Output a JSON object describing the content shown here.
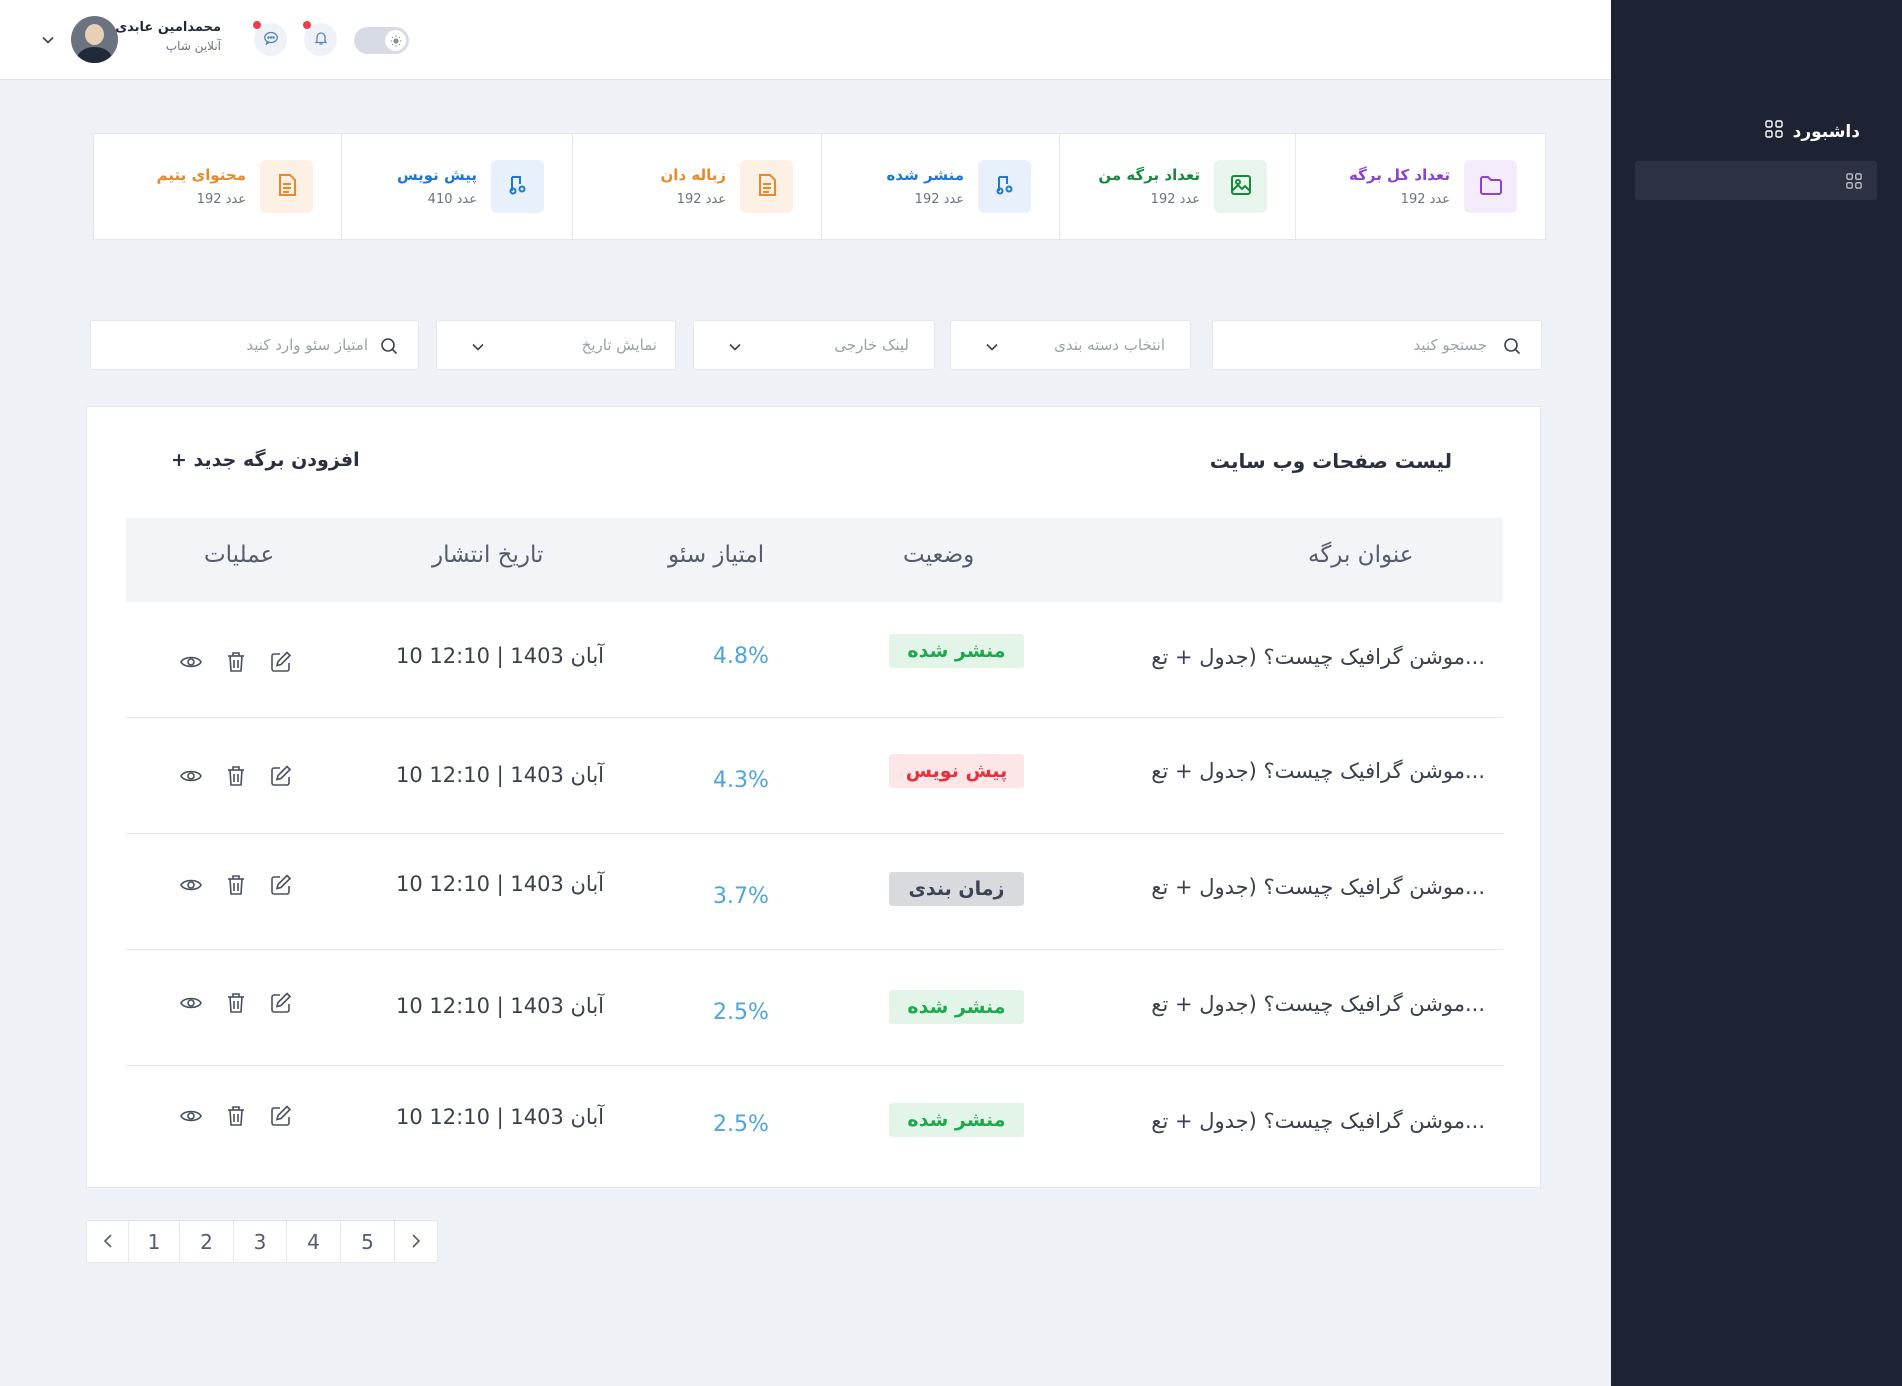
{
  "sidebar": {
    "title": "داشبورد",
    "title_icon": "grid-icon",
    "active_item_icon": "grid-icon"
  },
  "header": {
    "user_name": "محمدامین عابدی",
    "user_role": "آنلاین شاپ",
    "avatar": "user-avatar",
    "icons": [
      "chevron-down-icon",
      "chat-icon",
      "bell-icon",
      "theme-toggle"
    ],
    "notification_dot_color": "#ef3b4e"
  },
  "stats": [
    {
      "label": "تعداد کل برگه",
      "count": "192 عدد",
      "icon": "folder-icon",
      "color": "#8e3fd6",
      "bg": "#f4ecfb"
    },
    {
      "label": "تعداد برگه من",
      "count": "192 عدد",
      "icon": "image-icon",
      "color": "#168a3c",
      "bg": "#e8f5ec"
    },
    {
      "label": "منشر شده",
      "count": "192 عدد",
      "icon": "music-note-icon",
      "color": "#1f78d1",
      "bg": "#e8f1fb"
    },
    {
      "label": "زباله دان",
      "count": "192 عدد",
      "icon": "document-icon",
      "color": "#e98a2a",
      "bg": "#fdf1e6"
    },
    {
      "label": "پیش نویس",
      "count": "410 عدد",
      "icon": "music-note-icon",
      "color": "#1f78d1",
      "bg": "#e8f1fb"
    },
    {
      "label": "محتوای یتیم",
      "count": "192 عدد",
      "icon": "document-icon",
      "color": "#e98a2a",
      "bg": "#fdf1e6"
    }
  ],
  "filters": {
    "search_placeholder": "جستجو کنید",
    "category_placeholder": "انتخاب دسته بندی",
    "external_link_placeholder": "لینک خارجی",
    "date_placeholder": "نمایش تاریخ",
    "seo_placeholder": "امتیاز سئو وارد کنید"
  },
  "table": {
    "title": "لیست صفحات وب سایت",
    "add_label": "+ افزودن برگه جدید",
    "columns": {
      "title": "عنوان برگه",
      "status": "وضعیت",
      "seo": "امتیاز سئو",
      "date": "تاریخ انتشار",
      "ops": "عملیات"
    },
    "rows": [
      {
        "title": "موشن گرافیک چیست؟ (جدول + تع...",
        "status": "منشر شده",
        "status_color": "#1ea94e",
        "status_bg": "#e3f5e8",
        "seo": "4.8%",
        "date": "10 آبان 1403  |  12:10"
      },
      {
        "title": "موشن گرافیک چیست؟ (جدول + تع...",
        "status": "پیش نویس",
        "status_color": "#e8303c",
        "status_bg": "#fde6e8",
        "seo": "4.3%",
        "date": "10 آبان 1403  |  12:10"
      },
      {
        "title": "موشن گرافیک چیست؟ (جدول + تع...",
        "status": "زمان بندی",
        "status_color": "#3c4250",
        "status_bg": "#d9dadd",
        "seo": "3.7%",
        "date": "10 آبان 1403  |  12:10"
      },
      {
        "title": "موشن گرافیک چیست؟ (جدول + تع...",
        "status": "منشر شده",
        "status_color": "#1ea94e",
        "status_bg": "#e3f5e8",
        "seo": "2.5%",
        "date": "10 آبان 1403  |  12:10"
      },
      {
        "title": "موشن گرافیک چیست؟ (جدول + تع...",
        "status": "منشر شده",
        "status_color": "#1ea94e",
        "status_bg": "#e3f5e8",
        "seo": "2.5%",
        "date": "10 آبان 1403  |  12:10"
      }
    ]
  },
  "pagination": {
    "pages": [
      "1",
      "2",
      "3",
      "4",
      "5"
    ],
    "prev_icon": "chevron-left-icon",
    "next_icon": "chevron-right-icon"
  }
}
